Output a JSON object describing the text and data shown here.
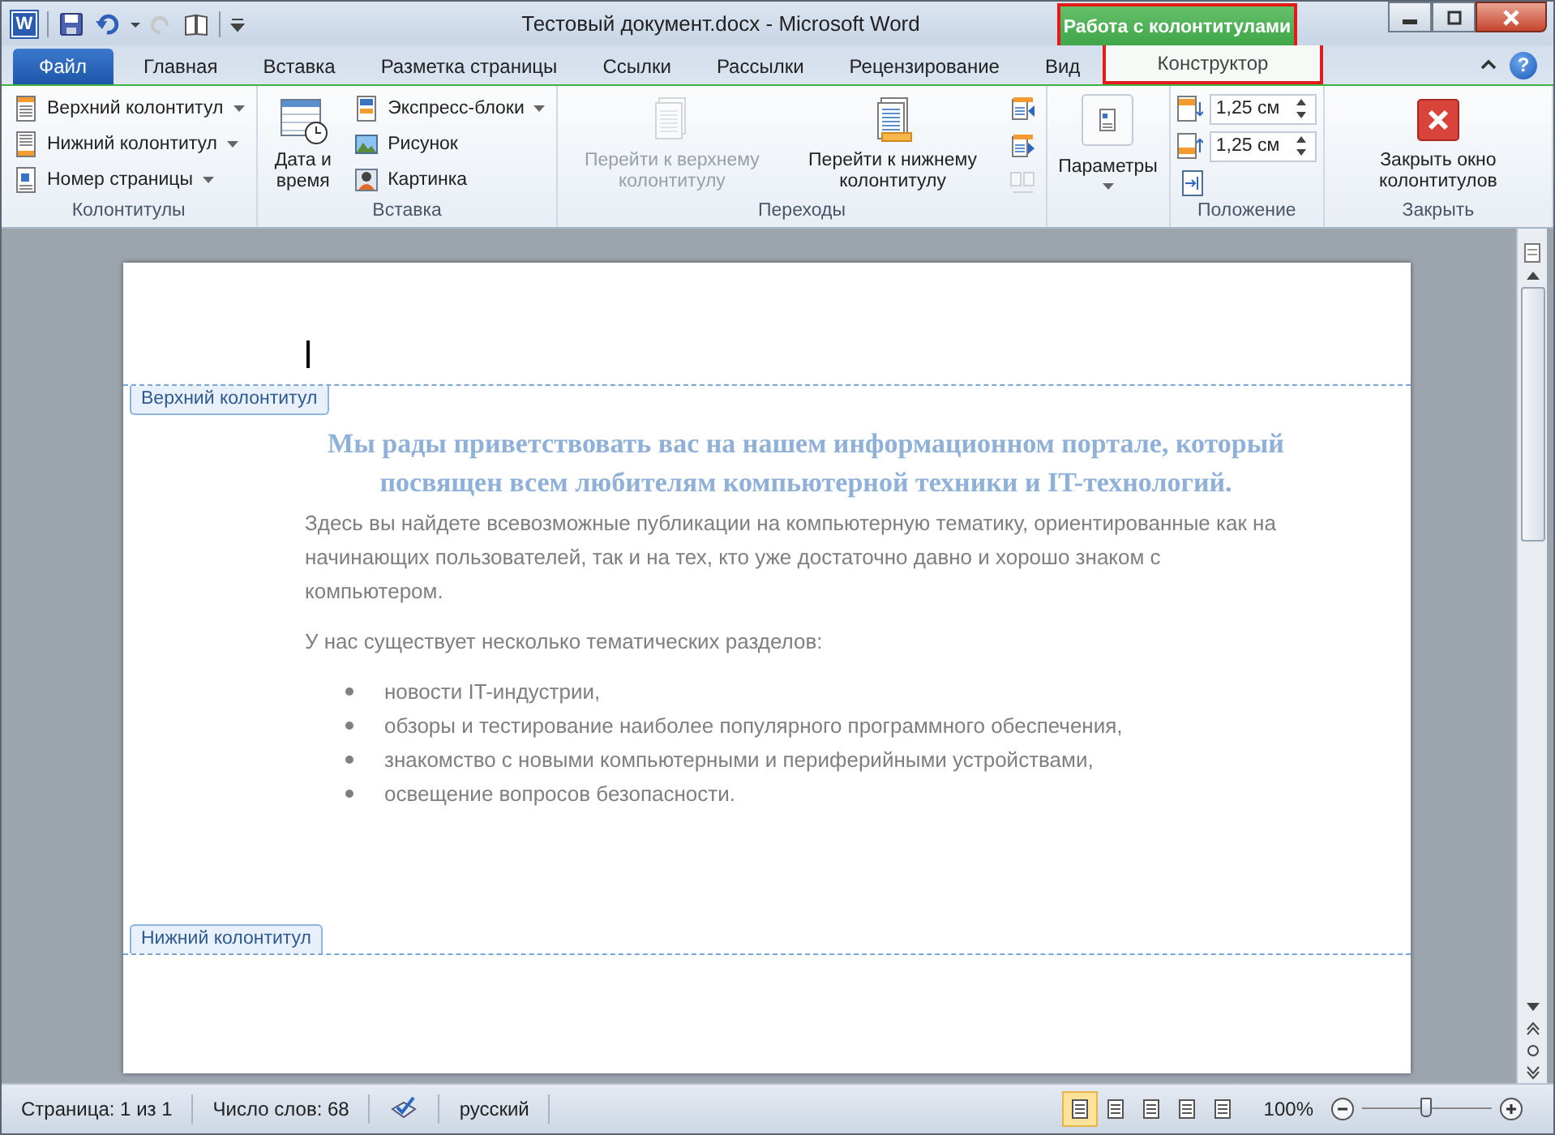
{
  "window": {
    "logo": "W",
    "title": "Тестовый документ.docx - Microsoft Word",
    "help": "?"
  },
  "context_group": {
    "title": "Работа с колонтитулами",
    "highlighted": true
  },
  "tabs": [
    {
      "label": "Файл",
      "kind": "file",
      "selected": false
    },
    {
      "label": "Главная",
      "kind": "normal",
      "selected": false
    },
    {
      "label": "Вставка",
      "kind": "normal",
      "selected": false
    },
    {
      "label": "Разметка страницы",
      "kind": "normal",
      "selected": false
    },
    {
      "label": "Ссылки",
      "kind": "normal",
      "selected": false
    },
    {
      "label": "Рассылки",
      "kind": "normal",
      "selected": false
    },
    {
      "label": "Рецензирование",
      "kind": "normal",
      "selected": false
    },
    {
      "label": "Вид",
      "kind": "normal",
      "selected": false
    },
    {
      "label": "Конструктор",
      "kind": "context",
      "selected": true
    }
  ],
  "ribbon": {
    "groups": [
      {
        "label": "Колонтитулы",
        "columns": [
          [
            {
              "kind": "small",
              "label": "Верхний колонтитул",
              "dropdown": true,
              "disabled": false
            },
            {
              "kind": "small",
              "label": "Нижний колонтитул",
              "dropdown": true,
              "disabled": false
            },
            {
              "kind": "small",
              "label": "Номер страницы",
              "dropdown": true,
              "disabled": false
            }
          ]
        ]
      },
      {
        "label": "Вставка",
        "columns": [
          [
            {
              "kind": "large",
              "label": "Дата и время",
              "dropdown": false,
              "disabled": false
            }
          ],
          [
            {
              "kind": "small",
              "label": "Экспресс-блоки",
              "dropdown": true,
              "disabled": false
            },
            {
              "kind": "small",
              "label": "Рисунок",
              "dropdown": false,
              "disabled": false
            },
            {
              "kind": "small",
              "label": "Картинка",
              "dropdown": false,
              "disabled": false
            }
          ]
        ]
      },
      {
        "label": "Переходы",
        "columns": [
          [
            {
              "kind": "large",
              "label": "Перейти к верхнему колонтитулу",
              "dropdown": false,
              "disabled": true
            }
          ],
          [
            {
              "kind": "large",
              "label": "Перейти к нижнему колонтитулу",
              "dropdown": false,
              "disabled": false
            }
          ],
          [
            {
              "kind": "icon",
              "disabled": false
            },
            {
              "kind": "icon",
              "disabled": false
            },
            {
              "kind": "icon",
              "disabled": true
            }
          ]
        ]
      },
      {
        "columns": [
          [
            {
              "kind": "large",
              "label": "Параметры",
              "dropdown": true,
              "disabled": false
            }
          ]
        ]
      },
      {
        "label": "Положение",
        "columns": [
          [
            {
              "kind": "spin",
              "value": "1,25 см"
            },
            {
              "kind": "spin",
              "value": "1,25 см"
            },
            {
              "kind": "icon",
              "disabled": false
            }
          ]
        ]
      },
      {
        "label": "Закрыть",
        "columns": [
          [
            {
              "kind": "large",
              "label": "Закрыть окно колонтитулов",
              "dropdown": false,
              "disabled": false
            }
          ]
        ]
      }
    ]
  },
  "document": {
    "header_label": "Верхний колонтитул",
    "footer_label": "Нижний колонтитул",
    "heading": "Мы рады приветствовать вас на нашем информационном портале, который посвящен всем любителям компьютерной техники и IT-технологий.",
    "paragraphs": [
      "Здесь вы найдете всевозможные публикации на компьютерную тематику, ориентированные как на начинающих пользователей, так и на тех, кто уже достаточно давно и хорошо знаком с компьютером.",
      "У нас существует несколько тематических разделов:"
    ],
    "bullets": [
      "новости IT-индустрии,",
      "обзоры и тестирование наиболее популярного программного обеспечения,",
      "знакомство с новыми компьютерными и периферийными устройствами,",
      "освещение вопросов безопасности."
    ]
  },
  "status_bar": {
    "page": "Страница: 1 из 1",
    "words": "Число слов: 68",
    "language": "русский",
    "views": [
      {
        "selected": true
      },
      {
        "selected": false
      },
      {
        "selected": false
      },
      {
        "selected": false
      },
      {
        "selected": false
      }
    ],
    "zoom": "100%",
    "zoom_level": {
      "level": 0.5
    }
  }
}
